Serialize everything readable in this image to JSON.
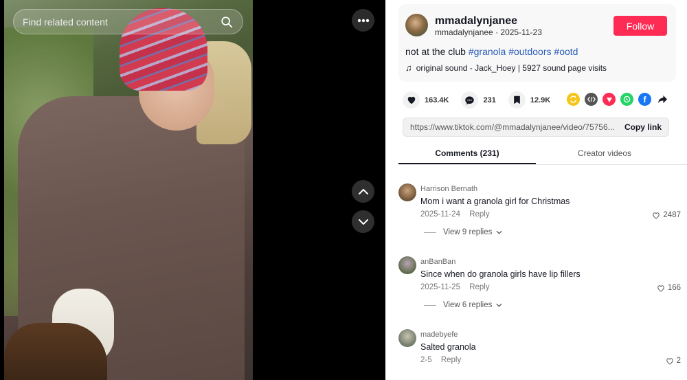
{
  "search": {
    "placeholder": "Find related content"
  },
  "post": {
    "username": "mmadalynjanee",
    "handle": "mmadalynjanee",
    "date": "2025-11-23",
    "follow_label": "Follow",
    "description": "not at the club",
    "hashtags": [
      "#granola",
      "#outdoors",
      "#ootd"
    ],
    "sound": "original sound - Jack_Hoey | 5927 sound page visits"
  },
  "stats": {
    "likes": "163.4K",
    "comments": "231",
    "saves": "12.9K"
  },
  "share": {
    "link": "https://www.tiktok.com/@mmadalynjanee/video/75756...",
    "copy_label": "Copy link",
    "icons": [
      "repost-icon",
      "embed-icon",
      "send-icon",
      "whatsapp-icon",
      "facebook-icon",
      "share-arrow-icon"
    ],
    "colors": {
      "repost": "#f5c518",
      "embed": "#555555",
      "send": "#fe2c55",
      "whatsapp": "#25d366",
      "facebook": "#1877f2"
    }
  },
  "tabs": [
    {
      "label": "Comments (231)"
    },
    {
      "label": "Creator videos"
    }
  ],
  "comments": [
    {
      "author": "Harrison Bernath",
      "text": "Mom i want a granola girl for Christmas",
      "date": "2025-11-24",
      "reply": "Reply",
      "likes": "2487",
      "replies": "View 9 replies"
    },
    {
      "author": "anBanBan",
      "text": "Since when do granola girls have lip fillers",
      "date": "2025-11-25",
      "reply": "Reply",
      "likes": "166",
      "replies": "View 6 replies"
    },
    {
      "author": "madebyefe",
      "text": "Salted granola",
      "date": "2-5",
      "reply": "Reply",
      "likes": "2"
    }
  ]
}
